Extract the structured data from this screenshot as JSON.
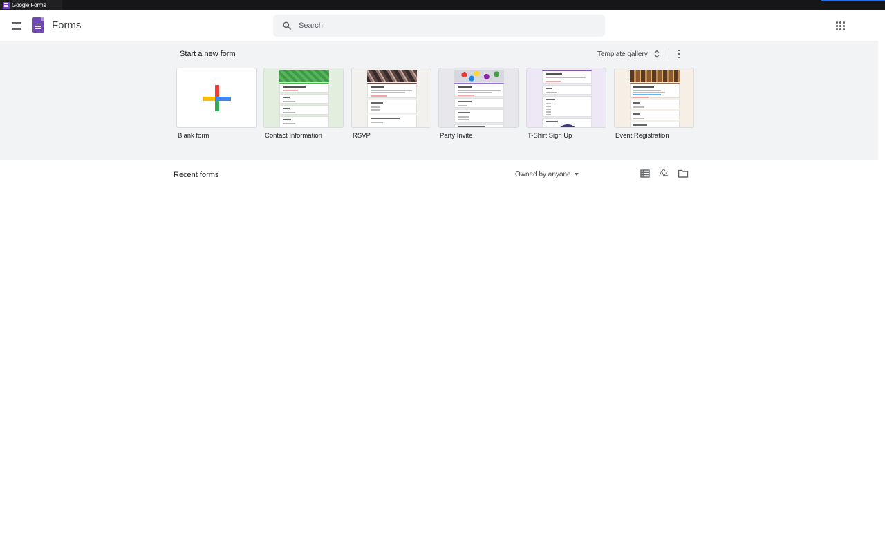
{
  "window": {
    "title": "Google Forms"
  },
  "header": {
    "app_name": "Forms",
    "search": {
      "placeholder": "Search",
      "value": ""
    },
    "icons": {
      "menu": "menu-icon",
      "logo": "forms-logo",
      "search": "search-icon",
      "apps": "apps-grid-icon"
    }
  },
  "templates_section": {
    "title": "Start a new form",
    "gallery_label": "Template gallery",
    "templates": [
      {
        "label": "Blank form"
      },
      {
        "label": "Contact Information"
      },
      {
        "label": "RSVP"
      },
      {
        "label": "Party Invite"
      },
      {
        "label": "T-Shirt Sign Up"
      },
      {
        "label": "Event Registration"
      }
    ]
  },
  "recent": {
    "title": "Recent forms",
    "owner_filter": "Owned by anyone",
    "sort_label": "AZ",
    "icons": {
      "list_view": "list-view-icon",
      "sort": "sort-az-icon",
      "folder": "folder-icon"
    }
  },
  "colors": {
    "brand_purple": "#7248b9",
    "plus_red": "#ea4335",
    "plus_blue": "#4285f4",
    "plus_green": "#34a853",
    "plus_yellow": "#fbbc04",
    "section_bg": "#f1f3f4"
  }
}
